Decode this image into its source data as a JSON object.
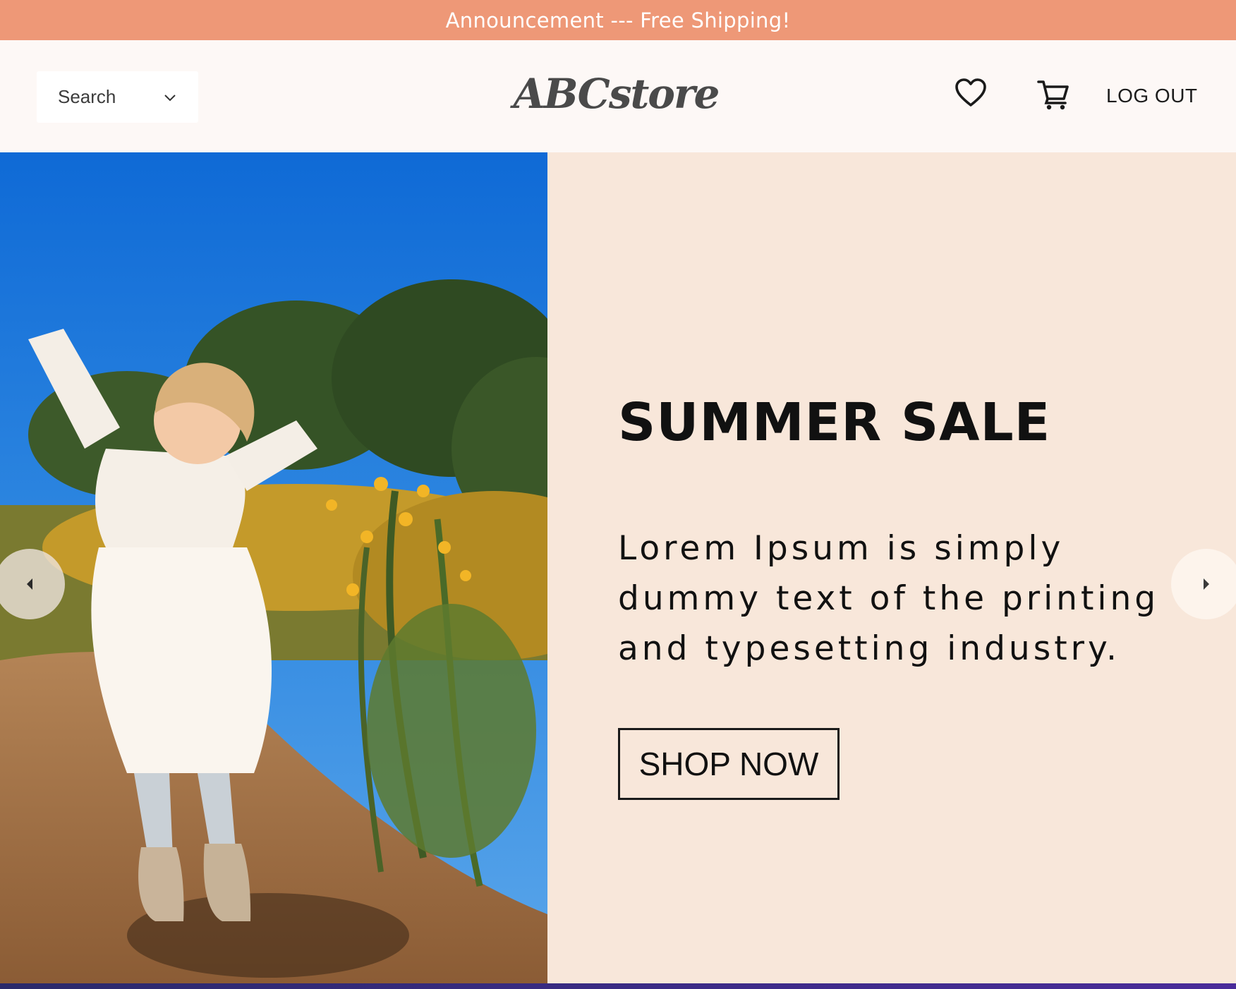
{
  "announcement": {
    "text": "Announcement --- Free Shipping!"
  },
  "header": {
    "search": {
      "label": "Search",
      "icon": "chevron-down-icon"
    },
    "logo": {
      "text": "ABCstore"
    },
    "icons": {
      "wishlist": "heart-icon",
      "cart": "cart-icon"
    },
    "logout_label": "LOG OUT"
  },
  "hero": {
    "title": "SUMMER SALE",
    "body": "Lorem Ipsum is simply dummy text of the printing and typesetting industry.",
    "cta_label": "SHOP NOW",
    "image_alt": "girl-jumping-in-flower-field-photo"
  },
  "carousel": {
    "prev_icon": "chevron-left-icon",
    "next_icon": "chevron-right-icon"
  },
  "colors": {
    "announcement_bg": "#ee9877",
    "header_bg": "#fdf8f6",
    "hero_panel_bg": "#f8e7da",
    "text_dark": "#111111"
  }
}
